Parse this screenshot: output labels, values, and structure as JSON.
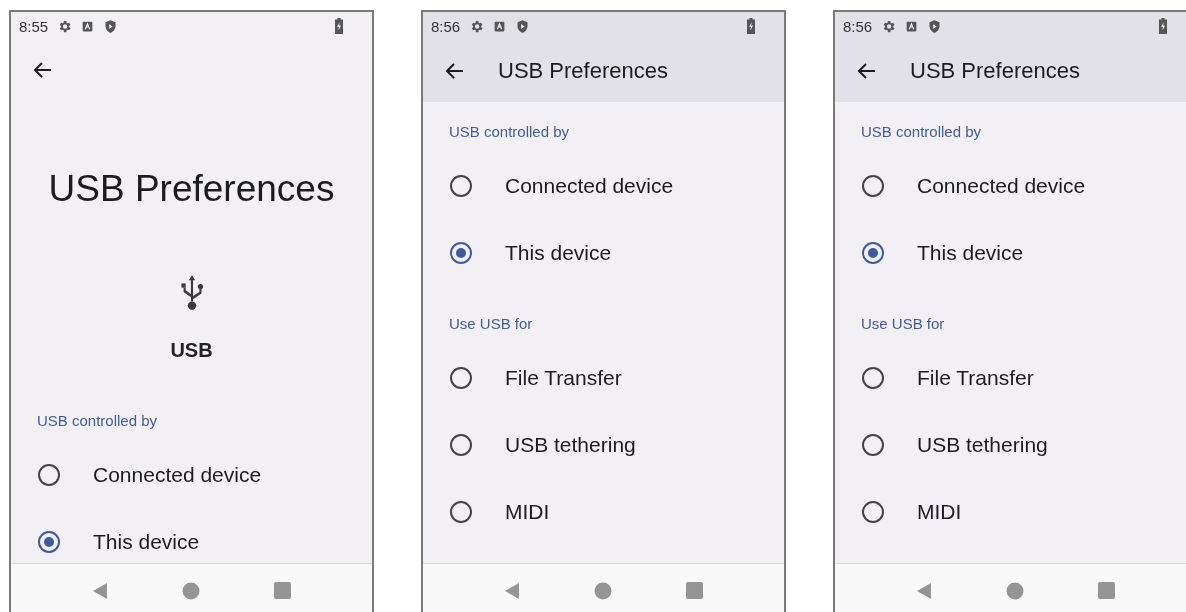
{
  "screens": [
    {
      "status_time": "8:55",
      "kind": "hero",
      "title": "USB Preferences",
      "hero_label": "USB",
      "sections": [
        {
          "header": "USB controlled by",
          "options": [
            {
              "label": "Connected device",
              "selected": false
            },
            {
              "label": "This device",
              "selected": true
            }
          ]
        }
      ]
    },
    {
      "status_time": "8:56",
      "kind": "toolbar",
      "title": "USB Preferences",
      "sections": [
        {
          "header": "USB controlled by",
          "options": [
            {
              "label": "Connected device",
              "selected": false
            },
            {
              "label": "This device",
              "selected": true
            }
          ]
        },
        {
          "header": "Use USB for",
          "options": [
            {
              "label": "File Transfer",
              "selected": false
            },
            {
              "label": "USB tethering",
              "selected": false
            },
            {
              "label": "MIDI",
              "selected": false
            }
          ]
        }
      ]
    },
    {
      "status_time": "8:56",
      "kind": "toolbar",
      "title": "USB Preferences",
      "sections": [
        {
          "header": "USB controlled by",
          "options": [
            {
              "label": "Connected device",
              "selected": false
            },
            {
              "label": "This device",
              "selected": true
            }
          ]
        },
        {
          "header": "Use USB for",
          "options": [
            {
              "label": "File Transfer",
              "selected": false
            },
            {
              "label": "USB tethering",
              "selected": false
            },
            {
              "label": "MIDI",
              "selected": false
            }
          ]
        }
      ]
    }
  ]
}
